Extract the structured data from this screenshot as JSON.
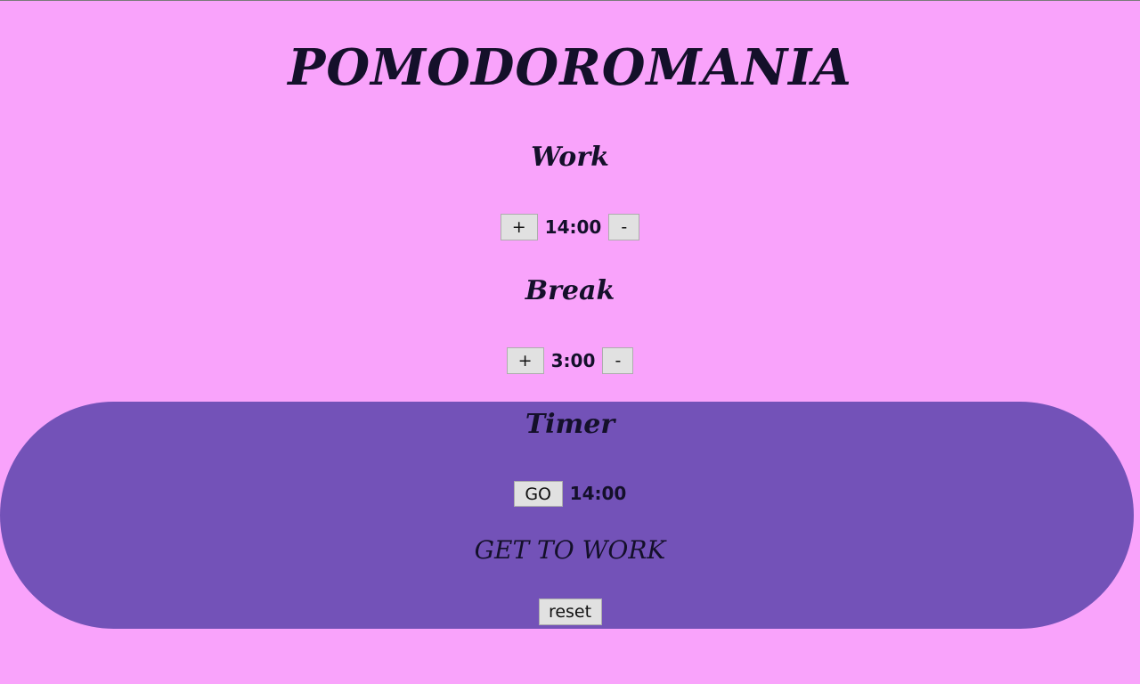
{
  "app": {
    "title": "POMODOROMANIA"
  },
  "work": {
    "heading": "Work",
    "increment_label": "+",
    "value": "14:00",
    "decrement_label": "-"
  },
  "break": {
    "heading": "Break",
    "increment_label": "+",
    "value": "3:00",
    "decrement_label": "-"
  },
  "timer": {
    "heading": "Timer",
    "go_label": "GO",
    "value": "14:00",
    "status": "GET TO WORK",
    "reset_label": "reset"
  },
  "colors": {
    "page_background": "#f9a3fb",
    "timer_background": "#7352b8",
    "text": "#14102a",
    "button_background": "#e1e1e1"
  }
}
